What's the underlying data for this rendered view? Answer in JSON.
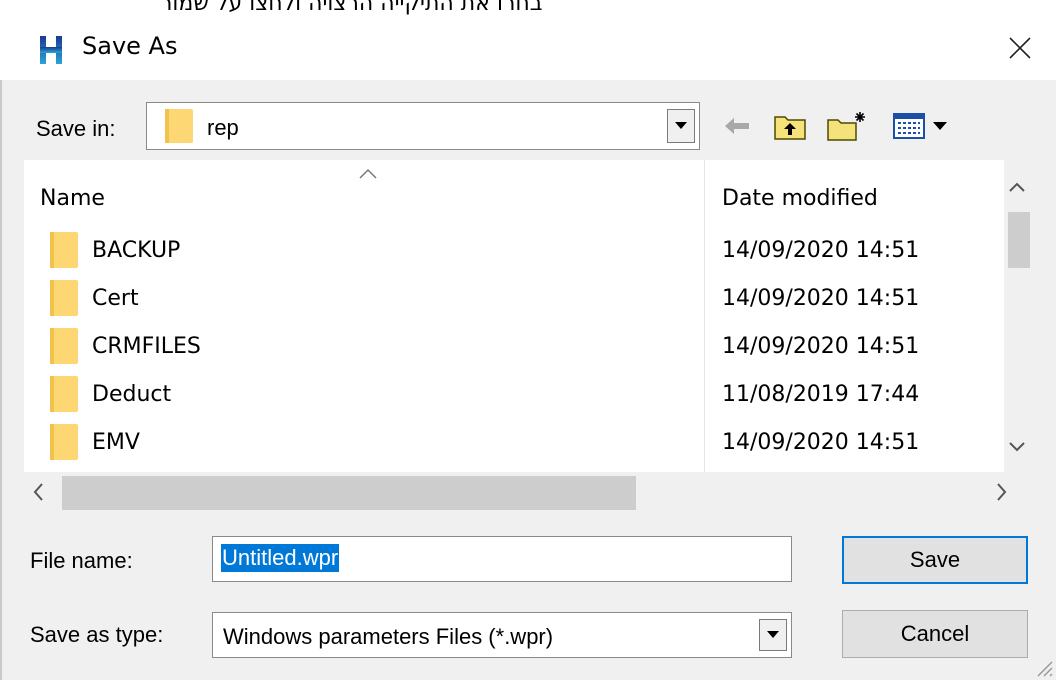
{
  "background_text": "בחרו את התיקייה הרצויה ולחצו על שמור",
  "window": {
    "title": "Save As"
  },
  "toolbar": {
    "save_in_label": "Save in:",
    "save_in_value": "rep"
  },
  "file_list": {
    "columns": {
      "name": "Name",
      "date": "Date modified"
    },
    "rows": [
      {
        "name": "BACKUP",
        "date": "14/09/2020 14:51"
      },
      {
        "name": "Cert",
        "date": "14/09/2020 14:51"
      },
      {
        "name": "CRMFILES",
        "date": "14/09/2020 14:51"
      },
      {
        "name": "Deduct",
        "date": "11/08/2019 17:44"
      },
      {
        "name": "EMV",
        "date": "14/09/2020 14:51"
      }
    ]
  },
  "form": {
    "file_name_label": "File name:",
    "file_name_value": "Untitled.wpr",
    "save_as_type_label": "Save as type:",
    "save_as_type_value": "Windows parameters Files (*.wpr)"
  },
  "buttons": {
    "save": "Save",
    "cancel": "Cancel"
  },
  "colors": {
    "accent": "#0078d7",
    "folder": "#fcd773",
    "app_icon_top": "#1a5fb4",
    "app_icon_bottom": "#2aa5d6"
  }
}
